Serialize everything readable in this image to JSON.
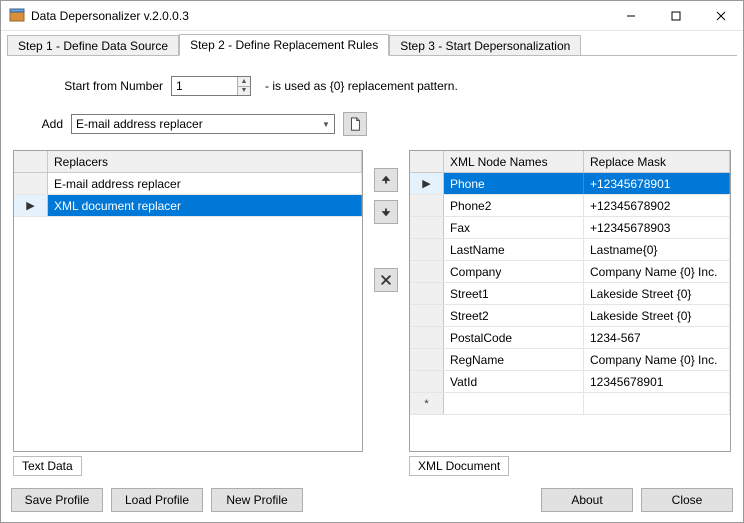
{
  "window": {
    "title": "Data Depersonalizer v.2.0.0.3"
  },
  "tabs": {
    "step1": "Step 1 - Define Data Source",
    "step2": "Step 2 - Define Replacement Rules",
    "step3": "Step 3 - Start Depersonalization"
  },
  "startFrom": {
    "label": "Start from Number",
    "value": "1",
    "hint": "- is used as {0} replacement pattern."
  },
  "add": {
    "label": "Add",
    "selected": "E-mail address replacer"
  },
  "replacers": {
    "header": "Replacers",
    "items": [
      {
        "name": "E-mail address replacer",
        "selected": false,
        "current": false
      },
      {
        "name": "XML document replacer",
        "selected": true,
        "current": true
      }
    ]
  },
  "xmlNodes": {
    "header_name": "XML Node Names",
    "header_mask": "Replace Mask",
    "rows": [
      {
        "name": "Phone",
        "mask": "+12345678901",
        "selected": true,
        "current": true
      },
      {
        "name": "Phone2",
        "mask": "+12345678902"
      },
      {
        "name": "Fax",
        "mask": "+12345678903"
      },
      {
        "name": "LastName",
        "mask": "Lastname{0}"
      },
      {
        "name": "Company",
        "mask": "Company Name {0} Inc."
      },
      {
        "name": "Street1",
        "mask": "Lakeside Street {0}"
      },
      {
        "name": "Street2",
        "mask": "Lakeside Street {0}"
      },
      {
        "name": "PostalCode",
        "mask": "1234-567"
      },
      {
        "name": "RegName",
        "mask": "Company Name {0} Inc."
      },
      {
        "name": "VatId",
        "mask": "12345678901"
      }
    ],
    "newrow_marker": "*"
  },
  "subtabs": {
    "textdata": "Text Data",
    "xmldoc": "XML Document"
  },
  "footer": {
    "saveProfile": "Save Profile",
    "loadProfile": "Load Profile",
    "newProfile": "New Profile",
    "about": "About",
    "close": "Close"
  }
}
